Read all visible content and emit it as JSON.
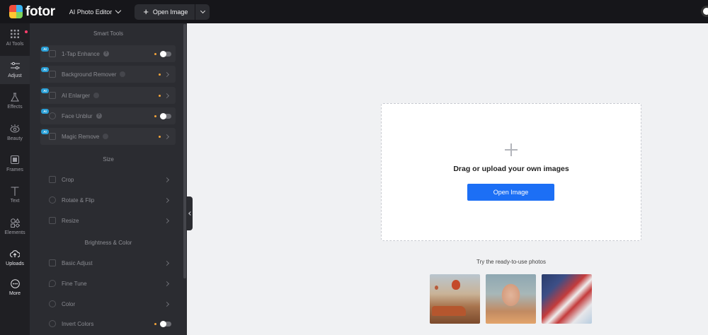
{
  "header": {
    "brand": "fotor",
    "app_select_label": "AI Photo Editor",
    "open_image_label": "Open Image"
  },
  "rail": {
    "items": [
      {
        "label": "AI Tools",
        "icon": "grid-icon"
      },
      {
        "label": "Adjust",
        "icon": "sliders-icon"
      },
      {
        "label": "Effects",
        "icon": "flask-icon"
      },
      {
        "label": "Beauty",
        "icon": "eye-icon"
      },
      {
        "label": "Frames",
        "icon": "frame-icon"
      },
      {
        "label": "Text",
        "icon": "text-icon"
      },
      {
        "label": "Elements",
        "icon": "shapes-icon"
      },
      {
        "label": "Uploads",
        "icon": "cloud-upload-icon"
      },
      {
        "label": "More",
        "icon": "more-icon"
      }
    ]
  },
  "panel": {
    "smart_tools_title": "Smart Tools",
    "ai_badge": "AI",
    "smart_tools": [
      {
        "label": "1-Tap Enhance",
        "control": "toggle",
        "help": "?"
      },
      {
        "label": "Background Remover",
        "control": "chevron"
      },
      {
        "label": "AI Enlarger",
        "control": "chevron"
      },
      {
        "label": "Face Unblur",
        "control": "toggle",
        "help": "?"
      },
      {
        "label": "Magic Remove",
        "control": "chevron"
      }
    ],
    "size_title": "Size",
    "size_tools": [
      {
        "label": "Crop"
      },
      {
        "label": "Rotate & Flip"
      },
      {
        "label": "Resize"
      }
    ],
    "brightness_title": "Brightness & Color",
    "brightness_tools": [
      {
        "label": "Basic Adjust"
      },
      {
        "label": "Fine Tune"
      },
      {
        "label": "Color"
      },
      {
        "label": "Invert Colors",
        "control": "toggle"
      }
    ]
  },
  "canvas": {
    "drop_text": "Drag or upload your own images",
    "open_button": "Open Image",
    "try_text": "Try the ready-to-use photos"
  },
  "colors": {
    "accent": "#1c6ff5",
    "topbar": "#16161a",
    "panel": "#2b2c31",
    "ai_badge": "#2a9fd6",
    "status_dot": "#f3a43a",
    "notification_dot": "#ff3e6c"
  }
}
